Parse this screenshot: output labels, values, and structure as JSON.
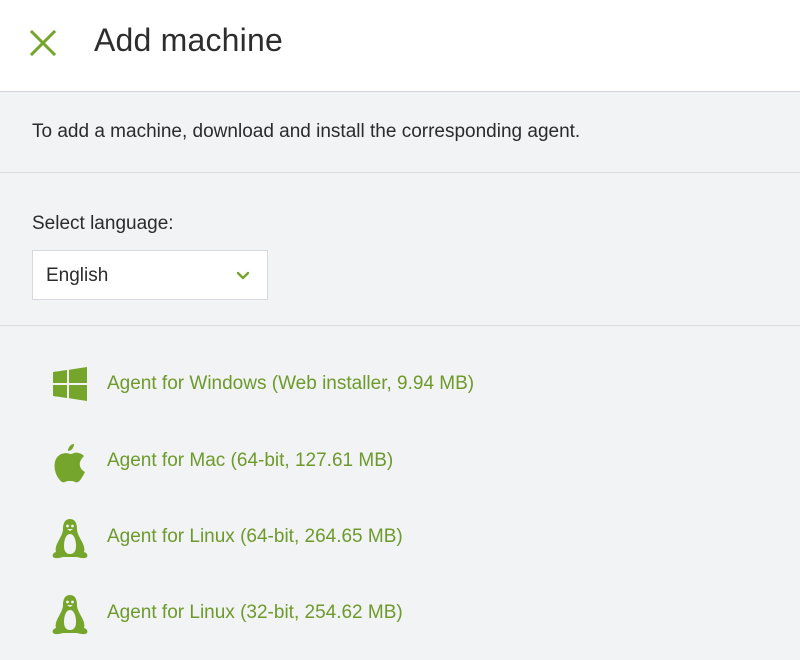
{
  "header": {
    "title": "Add machine",
    "close_icon": "close-icon"
  },
  "intro": {
    "text": "To add a machine, download and install the corresponding agent."
  },
  "language": {
    "label": "Select language:",
    "selected": "English"
  },
  "agents": [
    {
      "label": "Agent for Windows (Web installer, 9.94 MB)",
      "icon": "windows-icon"
    },
    {
      "label": "Agent for Mac (64-bit, 127.61 MB)",
      "icon": "apple-icon"
    },
    {
      "label": "Agent for Linux (64-bit, 264.65 MB)",
      "icon": "linux-icon"
    },
    {
      "label": "Agent for Linux (32-bit, 254.62 MB)",
      "icon": "linux-icon"
    }
  ],
  "colors": {
    "accent": "#6d9a2b",
    "background": "#f2f3f5",
    "header": "#ffffff"
  }
}
